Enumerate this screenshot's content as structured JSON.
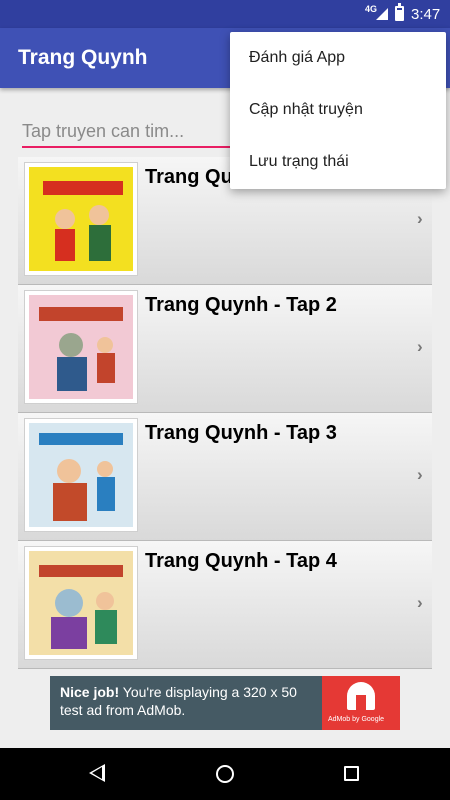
{
  "status_bar": {
    "network": "4G",
    "time": "3:47"
  },
  "app_bar": {
    "title": "Trang Quynh"
  },
  "search": {
    "placeholder": "Tap truyen can tim..."
  },
  "overflow_menu": {
    "items": [
      {
        "label": "Đánh giá App"
      },
      {
        "label": "Cập nhật truyện"
      },
      {
        "label": "Lưu trạng thái"
      }
    ]
  },
  "stories": [
    {
      "title": "Trang Quynh",
      "cover_colors": [
        "#f3e020",
        "#d62f1f",
        "#2d6e3a"
      ]
    },
    {
      "title": "Trang Quynh - Tap 2",
      "cover_colors": [
        "#f2c9d4",
        "#c2442c",
        "#2f5a8c"
      ]
    },
    {
      "title": "Trang Quynh - Tap 3",
      "cover_colors": [
        "#d7e7f0",
        "#2a7fc0",
        "#c24a2a"
      ]
    },
    {
      "title": "Trang Quynh - Tap 4",
      "cover_colors": [
        "#f3dfa8",
        "#7b3fa0",
        "#2e8a5b"
      ]
    }
  ],
  "ad": {
    "headline": "Nice job!",
    "body": "You're displaying a 320 x 50 test ad from AdMob.",
    "brand": "AdMob by Google",
    "colors": {
      "background": "#455a64",
      "logo_bg": "#e53935"
    }
  },
  "theme": {
    "primary": "#3f51b5",
    "primary_dark": "#303f9f",
    "accent": "#e91e63"
  },
  "nav_bar": {
    "icons": [
      "back-icon",
      "home-icon",
      "recents-icon"
    ]
  }
}
